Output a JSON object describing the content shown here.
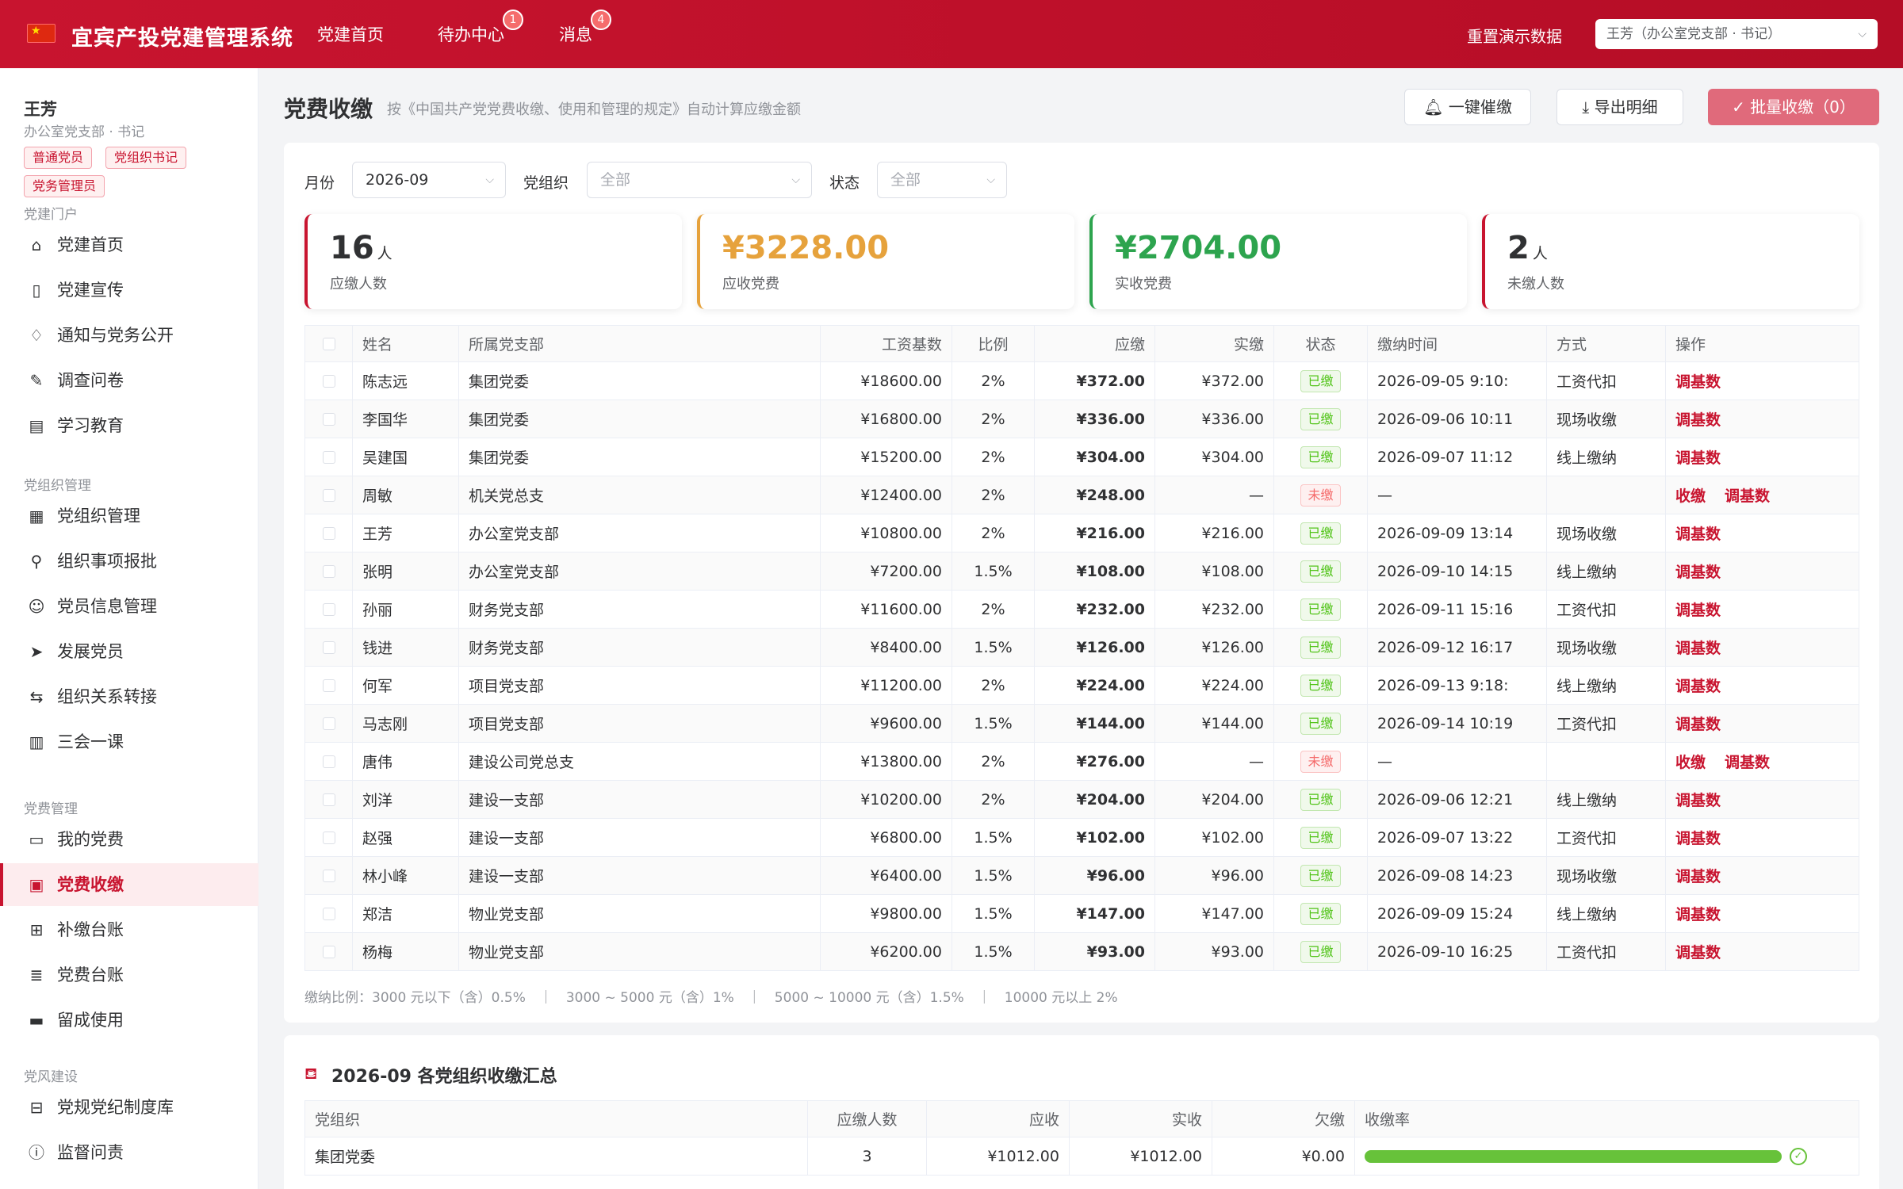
{
  "app": {
    "title": "宜宾产投党建管理系统",
    "nav": [
      {
        "label": "党建首页",
        "badge": null
      },
      {
        "label": "待办中心",
        "badge": "1"
      },
      {
        "label": "消息",
        "badge": "4"
      }
    ],
    "reset_label": "重置演示数据",
    "user_select": "王芳（办公室党支部 · 书记）"
  },
  "sidebar": {
    "user_name": "王芳",
    "user_dept": "办公室党支部 · 书记",
    "roles": [
      "普通党员",
      "党组织书记",
      "党务管理员"
    ],
    "groups": [
      {
        "title": "党建门户",
        "items": [
          {
            "label": "党建首页",
            "icon": "home-icon"
          },
          {
            "label": "党建宣传",
            "icon": "book-icon"
          },
          {
            "label": "通知与党务公开",
            "icon": "bell-icon"
          },
          {
            "label": "调查问卷",
            "icon": "pen-icon"
          },
          {
            "label": "学习教育",
            "icon": "notebook-icon"
          }
        ]
      },
      {
        "title": "党组织管理",
        "items": [
          {
            "label": "党组织管理",
            "icon": "building-icon"
          },
          {
            "label": "组织事项报批",
            "icon": "user-stamp-icon"
          },
          {
            "label": "党员信息管理",
            "icon": "user-icon"
          },
          {
            "label": "发展党员",
            "icon": "send-icon"
          },
          {
            "label": "组织关系转接",
            "icon": "transfer-icon"
          },
          {
            "label": "三会一课",
            "icon": "calendar-icon"
          }
        ]
      },
      {
        "title": "党费管理",
        "items": [
          {
            "label": "我的党费",
            "icon": "folder-icon"
          },
          {
            "label": "党费收缴",
            "icon": "wallet-icon",
            "active": true
          },
          {
            "label": "补缴台账",
            "icon": "file-plus-icon"
          },
          {
            "label": "党费台账",
            "icon": "document-icon"
          },
          {
            "label": "留成使用",
            "icon": "card-icon"
          }
        ]
      },
      {
        "title": "党风建设",
        "items": [
          {
            "label": "党规党纪制度库",
            "icon": "archive-icon"
          },
          {
            "label": "监督问责",
            "icon": "alert-circle-icon"
          }
        ]
      }
    ]
  },
  "page": {
    "title": "党费收缴",
    "subtitle": "按《中国共产党党费收缴、使用和管理的规定》自动计算应缴金额",
    "actions": {
      "remind": "一键催缴",
      "export": "导出明细",
      "batch": "批量收缴（0）"
    }
  },
  "filters": {
    "month_label": "月份",
    "month_value": "2026-09",
    "org_label": "党组织",
    "org_value": "全部",
    "status_label": "状态",
    "status_value": "全部"
  },
  "stats": [
    {
      "value": "16",
      "unit": "人",
      "label": "应缴人数",
      "color": "#303133",
      "border": "#c8142f"
    },
    {
      "value": "¥3228.00",
      "unit": "",
      "label": "应收党费",
      "color": "#e6a23c",
      "border": "#e6a23c"
    },
    {
      "value": "¥2704.00",
      "unit": "",
      "label": "实收党费",
      "color": "#2da44e",
      "border": "#2da44e"
    },
    {
      "value": "2",
      "unit": "人",
      "label": "未缴人数",
      "color": "#303133",
      "border": "#c8142f"
    }
  ],
  "table": {
    "headers": [
      "姓名",
      "所属党支部",
      "工资基数",
      "比例",
      "应缴",
      "实缴",
      "状态",
      "缴纳时间",
      "方式",
      "操作"
    ],
    "rows": [
      {
        "name": "陈志远",
        "branch": "集团党委",
        "base": "¥18600.00",
        "ratio": "2%",
        "due": "¥372.00",
        "paid": "¥372.00",
        "status": "已缴",
        "time": "2026-09-05 9:10:",
        "method": "工资代扣",
        "ops": [
          "调基数"
        ]
      },
      {
        "name": "李国华",
        "branch": "集团党委",
        "base": "¥16800.00",
        "ratio": "2%",
        "due": "¥336.00",
        "paid": "¥336.00",
        "status": "已缴",
        "time": "2026-09-06 10:11",
        "method": "现场收缴",
        "ops": [
          "调基数"
        ]
      },
      {
        "name": "吴建国",
        "branch": "集团党委",
        "base": "¥15200.00",
        "ratio": "2%",
        "due": "¥304.00",
        "paid": "¥304.00",
        "status": "已缴",
        "time": "2026-09-07 11:12",
        "method": "线上缴纳",
        "ops": [
          "调基数"
        ]
      },
      {
        "name": "周敏",
        "branch": "机关党总支",
        "base": "¥12400.00",
        "ratio": "2%",
        "due": "¥248.00",
        "paid": "—",
        "status": "未缴",
        "time": "—",
        "method": "",
        "ops": [
          "收缴",
          "调基数"
        ]
      },
      {
        "name": "王芳",
        "branch": "办公室党支部",
        "base": "¥10800.00",
        "ratio": "2%",
        "due": "¥216.00",
        "paid": "¥216.00",
        "status": "已缴",
        "time": "2026-09-09 13:14",
        "method": "现场收缴",
        "ops": [
          "调基数"
        ]
      },
      {
        "name": "张明",
        "branch": "办公室党支部",
        "base": "¥7200.00",
        "ratio": "1.5%",
        "due": "¥108.00",
        "paid": "¥108.00",
        "status": "已缴",
        "time": "2026-09-10 14:15",
        "method": "线上缴纳",
        "ops": [
          "调基数"
        ]
      },
      {
        "name": "孙丽",
        "branch": "财务党支部",
        "base": "¥11600.00",
        "ratio": "2%",
        "due": "¥232.00",
        "paid": "¥232.00",
        "status": "已缴",
        "time": "2026-09-11 15:16",
        "method": "工资代扣",
        "ops": [
          "调基数"
        ]
      },
      {
        "name": "钱进",
        "branch": "财务党支部",
        "base": "¥8400.00",
        "ratio": "1.5%",
        "due": "¥126.00",
        "paid": "¥126.00",
        "status": "已缴",
        "time": "2026-09-12 16:17",
        "method": "现场收缴",
        "ops": [
          "调基数"
        ]
      },
      {
        "name": "何军",
        "branch": "项目党支部",
        "base": "¥11200.00",
        "ratio": "2%",
        "due": "¥224.00",
        "paid": "¥224.00",
        "status": "已缴",
        "time": "2026-09-13 9:18:",
        "method": "线上缴纳",
        "ops": [
          "调基数"
        ]
      },
      {
        "name": "马志刚",
        "branch": "项目党支部",
        "base": "¥9600.00",
        "ratio": "1.5%",
        "due": "¥144.00",
        "paid": "¥144.00",
        "status": "已缴",
        "time": "2026-09-14 10:19",
        "method": "工资代扣",
        "ops": [
          "调基数"
        ]
      },
      {
        "name": "唐伟",
        "branch": "建设公司党总支",
        "base": "¥13800.00",
        "ratio": "2%",
        "due": "¥276.00",
        "paid": "—",
        "status": "未缴",
        "time": "—",
        "method": "",
        "ops": [
          "收缴",
          "调基数"
        ]
      },
      {
        "name": "刘洋",
        "branch": "建设一支部",
        "base": "¥10200.00",
        "ratio": "2%",
        "due": "¥204.00",
        "paid": "¥204.00",
        "status": "已缴",
        "time": "2026-09-06 12:21",
        "method": "线上缴纳",
        "ops": [
          "调基数"
        ]
      },
      {
        "name": "赵强",
        "branch": "建设一支部",
        "base": "¥6800.00",
        "ratio": "1.5%",
        "due": "¥102.00",
        "paid": "¥102.00",
        "status": "已缴",
        "time": "2026-09-07 13:22",
        "method": "工资代扣",
        "ops": [
          "调基数"
        ]
      },
      {
        "name": "林小峰",
        "branch": "建设一支部",
        "base": "¥6400.00",
        "ratio": "1.5%",
        "due": "¥96.00",
        "paid": "¥96.00",
        "status": "已缴",
        "time": "2026-09-08 14:23",
        "method": "现场收缴",
        "ops": [
          "调基数"
        ]
      },
      {
        "name": "郑洁",
        "branch": "物业党支部",
        "base": "¥9800.00",
        "ratio": "1.5%",
        "due": "¥147.00",
        "paid": "¥147.00",
        "status": "已缴",
        "time": "2026-09-09 15:24",
        "method": "线上缴纳",
        "ops": [
          "调基数"
        ]
      },
      {
        "name": "杨梅",
        "branch": "物业党支部",
        "base": "¥6200.00",
        "ratio": "1.5%",
        "due": "¥93.00",
        "paid": "¥93.00",
        "status": "已缴",
        "time": "2026-09-10 16:25",
        "method": "工资代扣",
        "ops": [
          "调基数"
        ]
      }
    ]
  },
  "rate_note": "缴纳比例：3000 元以下（含）0.5%　｜　3000 ~ 5000 元（含）1%　｜　5000 ~ 10000 元（含）1.5%　｜　10000 元以上 2%",
  "summary": {
    "title": "2026-09 各党组织收缴汇总",
    "headers": [
      "党组织",
      "应缴人数",
      "应收",
      "实收",
      "欠缴",
      "收缴率"
    ],
    "rows": [
      {
        "org": "集团党委",
        "count": "3",
        "due": "¥1012.00",
        "paid": "¥1012.00",
        "owed": "¥0.00",
        "rate": 1.0
      }
    ]
  }
}
